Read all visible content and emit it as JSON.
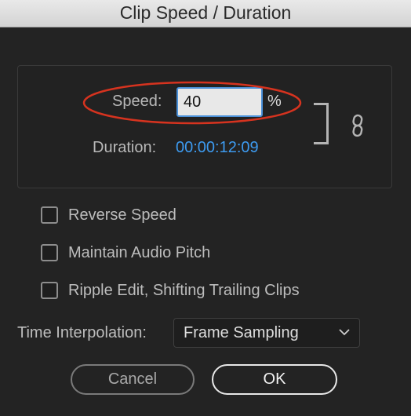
{
  "window": {
    "title": "Clip Speed / Duration"
  },
  "speed": {
    "label": "Speed:",
    "value": "40",
    "unit": "%"
  },
  "duration": {
    "label": "Duration:",
    "value": "00:00:12:09"
  },
  "options": {
    "reverse_speed": {
      "label": "Reverse Speed",
      "checked": false
    },
    "maintain_audio_pitch": {
      "label": "Maintain Audio Pitch",
      "checked": false
    },
    "ripple_edit": {
      "label": "Ripple Edit, Shifting Trailing Clips",
      "checked": false
    }
  },
  "time_interpolation": {
    "label": "Time Interpolation:",
    "selected": "Frame Sampling"
  },
  "buttons": {
    "cancel": "Cancel",
    "ok": "OK"
  },
  "colors": {
    "accent_blue": "#3d9aef",
    "highlight_red": "#d6331f",
    "background": "#232323"
  },
  "icons": {
    "link": "chain-link-icon",
    "dropdown": "chevron-down-icon"
  }
}
